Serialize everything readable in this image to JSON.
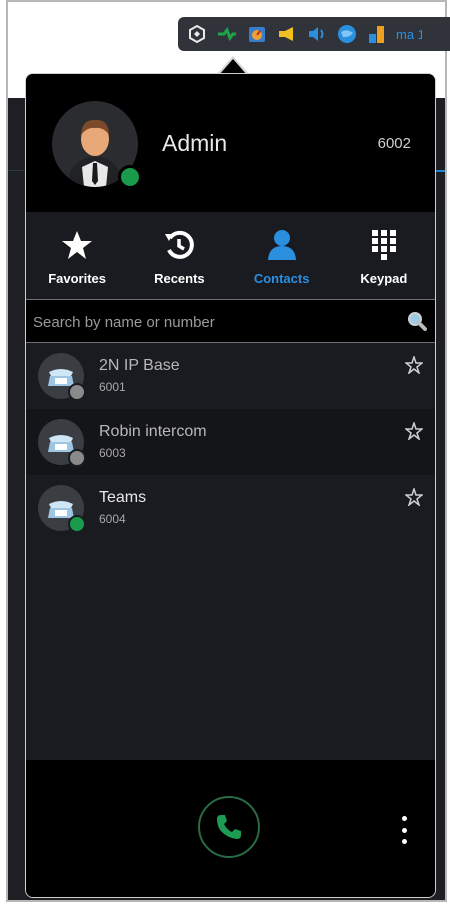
{
  "tray": {
    "text": "ma 1",
    "icons": [
      "app-logo-icon",
      "network-icon",
      "speedometer-icon",
      "megaphone-icon",
      "volume-icon",
      "globe-icon",
      "signal-icon"
    ]
  },
  "user": {
    "name": "Admin",
    "extension": "6002",
    "status_color": "#1a9a4b"
  },
  "tabs": [
    {
      "label": "Favorites",
      "icon": "star-icon",
      "active": false
    },
    {
      "label": "Recents",
      "icon": "history-icon",
      "active": false
    },
    {
      "label": "Contacts",
      "icon": "contact-icon",
      "active": true
    },
    {
      "label": "Keypad",
      "icon": "keypad-icon",
      "active": false
    }
  ],
  "search": {
    "placeholder": "Search by name or number",
    "value": ""
  },
  "contacts": [
    {
      "name": "2N IP Base",
      "extension": "6001",
      "status": "offline",
      "status_color": "#8a8a8a"
    },
    {
      "name": "Robin intercom",
      "extension": "6003",
      "status": "offline",
      "status_color": "#8a8a8a"
    },
    {
      "name": "Teams",
      "extension": "6004",
      "status": "online",
      "status_color": "#1a9a4b"
    }
  ],
  "colors": {
    "accent": "#2b8fe0",
    "online": "#1a9a4b",
    "call": "#1f9a52"
  }
}
